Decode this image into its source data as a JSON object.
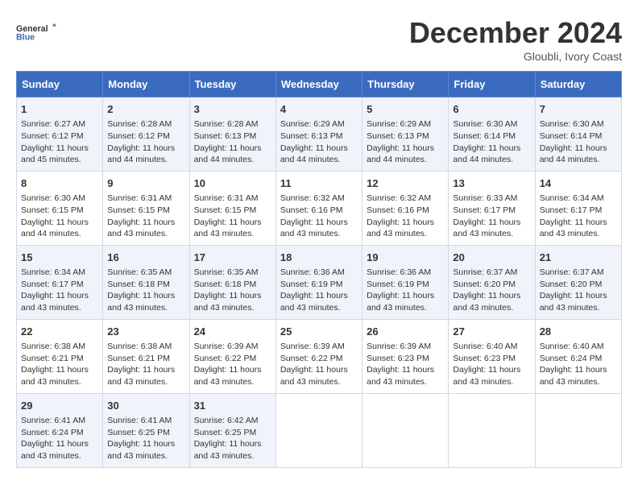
{
  "logo": {
    "line1": "General",
    "line2": "Blue"
  },
  "header": {
    "month": "December 2024",
    "location": "Gloubli, Ivory Coast"
  },
  "days_of_week": [
    "Sunday",
    "Monday",
    "Tuesday",
    "Wednesday",
    "Thursday",
    "Friday",
    "Saturday"
  ],
  "weeks": [
    [
      {
        "day": "1",
        "sunrise": "6:27 AM",
        "sunset": "6:12 PM",
        "daylight": "11 hours and 45 minutes."
      },
      {
        "day": "2",
        "sunrise": "6:28 AM",
        "sunset": "6:12 PM",
        "daylight": "11 hours and 44 minutes."
      },
      {
        "day": "3",
        "sunrise": "6:28 AM",
        "sunset": "6:13 PM",
        "daylight": "11 hours and 44 minutes."
      },
      {
        "day": "4",
        "sunrise": "6:29 AM",
        "sunset": "6:13 PM",
        "daylight": "11 hours and 44 minutes."
      },
      {
        "day": "5",
        "sunrise": "6:29 AM",
        "sunset": "6:13 PM",
        "daylight": "11 hours and 44 minutes."
      },
      {
        "day": "6",
        "sunrise": "6:30 AM",
        "sunset": "6:14 PM",
        "daylight": "11 hours and 44 minutes."
      },
      {
        "day": "7",
        "sunrise": "6:30 AM",
        "sunset": "6:14 PM",
        "daylight": "11 hours and 44 minutes."
      }
    ],
    [
      {
        "day": "8",
        "sunrise": "6:30 AM",
        "sunset": "6:15 PM",
        "daylight": "11 hours and 44 minutes."
      },
      {
        "day": "9",
        "sunrise": "6:31 AM",
        "sunset": "6:15 PM",
        "daylight": "11 hours and 43 minutes."
      },
      {
        "day": "10",
        "sunrise": "6:31 AM",
        "sunset": "6:15 PM",
        "daylight": "11 hours and 43 minutes."
      },
      {
        "day": "11",
        "sunrise": "6:32 AM",
        "sunset": "6:16 PM",
        "daylight": "11 hours and 43 minutes."
      },
      {
        "day": "12",
        "sunrise": "6:32 AM",
        "sunset": "6:16 PM",
        "daylight": "11 hours and 43 minutes."
      },
      {
        "day": "13",
        "sunrise": "6:33 AM",
        "sunset": "6:17 PM",
        "daylight": "11 hours and 43 minutes."
      },
      {
        "day": "14",
        "sunrise": "6:34 AM",
        "sunset": "6:17 PM",
        "daylight": "11 hours and 43 minutes."
      }
    ],
    [
      {
        "day": "15",
        "sunrise": "6:34 AM",
        "sunset": "6:17 PM",
        "daylight": "11 hours and 43 minutes."
      },
      {
        "day": "16",
        "sunrise": "6:35 AM",
        "sunset": "6:18 PM",
        "daylight": "11 hours and 43 minutes."
      },
      {
        "day": "17",
        "sunrise": "6:35 AM",
        "sunset": "6:18 PM",
        "daylight": "11 hours and 43 minutes."
      },
      {
        "day": "18",
        "sunrise": "6:36 AM",
        "sunset": "6:19 PM",
        "daylight": "11 hours and 43 minutes."
      },
      {
        "day": "19",
        "sunrise": "6:36 AM",
        "sunset": "6:19 PM",
        "daylight": "11 hours and 43 minutes."
      },
      {
        "day": "20",
        "sunrise": "6:37 AM",
        "sunset": "6:20 PM",
        "daylight": "11 hours and 43 minutes."
      },
      {
        "day": "21",
        "sunrise": "6:37 AM",
        "sunset": "6:20 PM",
        "daylight": "11 hours and 43 minutes."
      }
    ],
    [
      {
        "day": "22",
        "sunrise": "6:38 AM",
        "sunset": "6:21 PM",
        "daylight": "11 hours and 43 minutes."
      },
      {
        "day": "23",
        "sunrise": "6:38 AM",
        "sunset": "6:21 PM",
        "daylight": "11 hours and 43 minutes."
      },
      {
        "day": "24",
        "sunrise": "6:39 AM",
        "sunset": "6:22 PM",
        "daylight": "11 hours and 43 minutes."
      },
      {
        "day": "25",
        "sunrise": "6:39 AM",
        "sunset": "6:22 PM",
        "daylight": "11 hours and 43 minutes."
      },
      {
        "day": "26",
        "sunrise": "6:39 AM",
        "sunset": "6:23 PM",
        "daylight": "11 hours and 43 minutes."
      },
      {
        "day": "27",
        "sunrise": "6:40 AM",
        "sunset": "6:23 PM",
        "daylight": "11 hours and 43 minutes."
      },
      {
        "day": "28",
        "sunrise": "6:40 AM",
        "sunset": "6:24 PM",
        "daylight": "11 hours and 43 minutes."
      }
    ],
    [
      {
        "day": "29",
        "sunrise": "6:41 AM",
        "sunset": "6:24 PM",
        "daylight": "11 hours and 43 minutes."
      },
      {
        "day": "30",
        "sunrise": "6:41 AM",
        "sunset": "6:25 PM",
        "daylight": "11 hours and 43 minutes."
      },
      {
        "day": "31",
        "sunrise": "6:42 AM",
        "sunset": "6:25 PM",
        "daylight": "11 hours and 43 minutes."
      },
      null,
      null,
      null,
      null
    ]
  ],
  "labels": {
    "sunrise": "Sunrise:",
    "sunset": "Sunset:",
    "daylight": "Daylight:"
  }
}
